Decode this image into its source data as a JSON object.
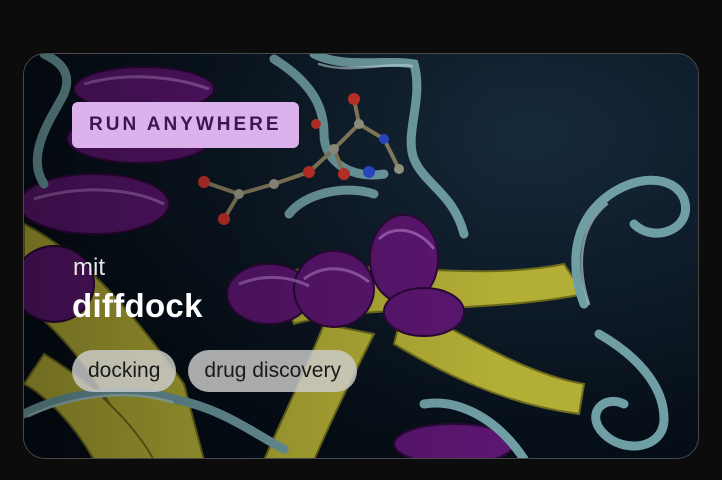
{
  "card": {
    "badge": "RUN ANYWHERE",
    "organization": "mit",
    "model_name": "diffdock",
    "tags": [
      "docking",
      "drug discovery"
    ],
    "background_image": "protein-ligand-ribbon-structure"
  },
  "colors": {
    "page_background": "#0c0c0c",
    "badge_background": "#dcb2ec",
    "badge_text": "#3c1554",
    "tag_background": "#cdcdcd",
    "helix_purple": "#5a1670",
    "sheet_yellow": "#b8b43a",
    "coil_teal": "#6f9ea4"
  }
}
